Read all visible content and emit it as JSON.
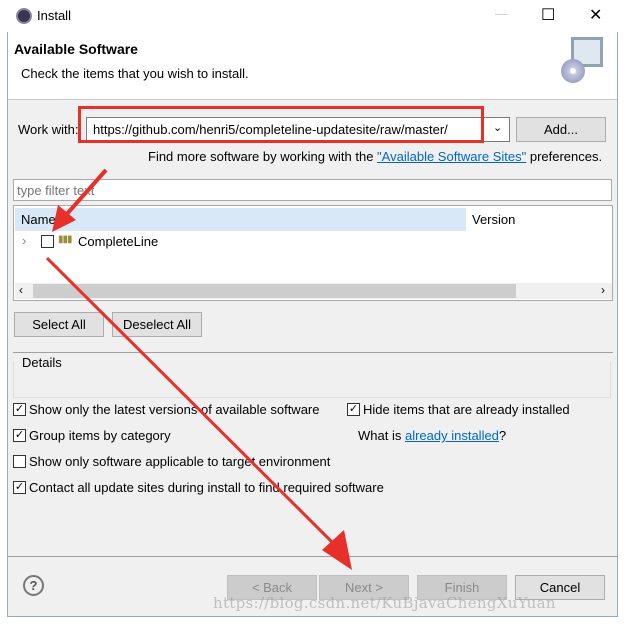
{
  "window": {
    "title": "Install",
    "minimize": "—",
    "maximize": "☐",
    "close": "✕"
  },
  "header": {
    "title": "Available Software",
    "subtitle": "Check the items that you wish to install."
  },
  "work_with": {
    "label": "Work with:",
    "value": "https://github.com/henri5/completeline-updatesite/raw/master/",
    "add_button": "Add..."
  },
  "find_more": {
    "prefix": "Find more software by working with the ",
    "link": "\"Available Software Sites\"",
    "suffix": " preferences."
  },
  "filter": {
    "placeholder": "type filter text"
  },
  "table": {
    "columns": [
      "Name",
      "Version"
    ],
    "rows": [
      {
        "name": "CompleteLine",
        "version": "",
        "checked": false
      }
    ]
  },
  "buttons": {
    "select_all": "Select All",
    "deselect_all": "Deselect All"
  },
  "details": {
    "label": "Details"
  },
  "options": [
    {
      "label": "Show only the latest versions of available software",
      "checked": true
    },
    {
      "label": "Hide items that are already installed",
      "checked": true
    },
    {
      "label": "Group items by category",
      "checked": true
    },
    {
      "label": "Show only software applicable to target environment",
      "checked": false
    },
    {
      "label": "Contact all update sites during install to find required software",
      "checked": true
    }
  ],
  "installed": {
    "prefix": "What is ",
    "link": "already installed",
    "suffix": "?"
  },
  "footer": {
    "help": "?",
    "back": "< Back",
    "next": "Next >",
    "finish": "Finish",
    "cancel": "Cancel"
  },
  "watermark": "https://blog.csdn.net/KuBjavaChengXuYuan",
  "colors": {
    "annotation": "#e8302a",
    "link": "#0066cc",
    "header_selected": "#d9e8f7"
  }
}
